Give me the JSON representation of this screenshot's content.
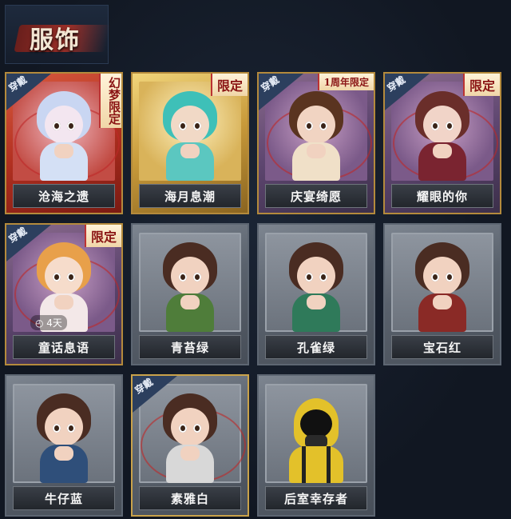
{
  "header": {
    "title": "服饰"
  },
  "cards": [
    {
      "label": "沧海之遗",
      "style": "red",
      "tag": "幻梦限定",
      "tag_type": "vertical",
      "wearing": true,
      "hair": "#c9d6f2",
      "face": "#f3e6f0",
      "body": "#d4e0f5"
    },
    {
      "label": "海月息潮",
      "style": "gold",
      "tag": "限定",
      "tag_type": "normal",
      "wearing": false,
      "hair": "#3ec0b8",
      "face": "#f1d9c6",
      "body": "#5bc7c0"
    },
    {
      "label": "庆宴绮愿",
      "style": "purple",
      "tag": "1周年限定",
      "tag_type": "small",
      "wearing": true,
      "hair": "#5a3420",
      "face": "#f1d4c2",
      "body": "#f0e0c8"
    },
    {
      "label": "耀眼的你",
      "style": "purple",
      "tag": "限定",
      "tag_type": "normal",
      "wearing": true,
      "hair": "#6a2e2a",
      "face": "#f1d4c8",
      "body": "#7a2430"
    },
    {
      "label": "童话息语",
      "style": "purple",
      "tag": "限定",
      "tag_type": "normal",
      "wearing": true,
      "timer": "4天",
      "hair": "#e8a04a",
      "face": "#f6dccb",
      "body": "#f3e8e8"
    },
    {
      "label": "青苔绿",
      "style": "grey",
      "wearing": false,
      "hair": "#4a2c22",
      "face": "#f1d2c0",
      "body": "#4f7d3a"
    },
    {
      "label": "孔雀绿",
      "style": "grey",
      "wearing": false,
      "hair": "#4a2c22",
      "face": "#f1d2c0",
      "body": "#2f7a5a"
    },
    {
      "label": "宝石红",
      "style": "grey",
      "wearing": false,
      "hair": "#4a2c22",
      "face": "#f1d2c0",
      "body": "#8a2a26"
    },
    {
      "label": "牛仔蓝",
      "style": "grey",
      "wearing": false,
      "hair": "#4a2c22",
      "face": "#f1d2c0",
      "body": "#2f4f7a"
    },
    {
      "label": "素雅白",
      "style": "grey-gold",
      "wearing": true,
      "hair": "#4a2c22",
      "face": "#f1d2c0",
      "body": "#d8d8d8"
    },
    {
      "label": "后室幸存者",
      "style": "grey",
      "wearing": false,
      "hazmat": true
    }
  ],
  "wear_label": "穿戴",
  "icons": {
    "timer": "clock-icon"
  }
}
